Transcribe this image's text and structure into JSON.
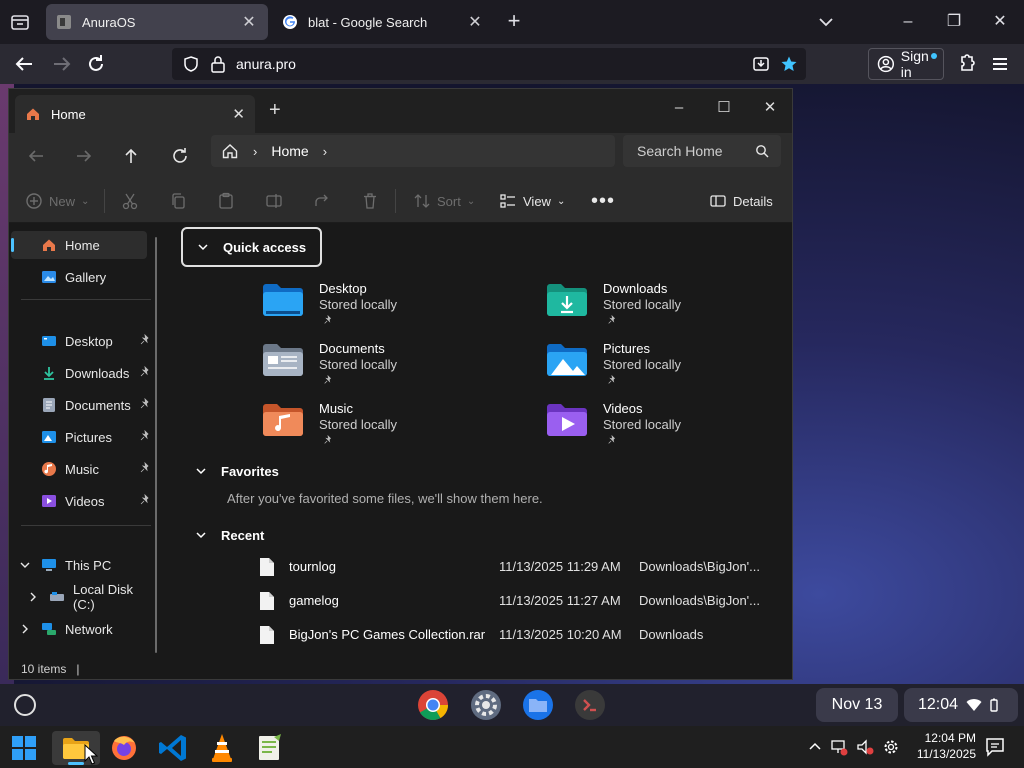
{
  "browser": {
    "tabs": [
      {
        "title": "AnuraOS",
        "active": true
      },
      {
        "title": "blat - Google Search",
        "active": false
      }
    ],
    "url": "anura.pro",
    "sign_in": "Sign in"
  },
  "explorer": {
    "tab_title": "Home",
    "breadcrumb": [
      "Home"
    ],
    "search_placeholder": "Search Home",
    "toolbar": {
      "new": "New",
      "sort": "Sort",
      "view": "View",
      "details": "Details"
    },
    "sidebar": {
      "home": "Home",
      "gallery": "Gallery",
      "quick": [
        {
          "label": "Desktop"
        },
        {
          "label": "Downloads"
        },
        {
          "label": "Documents"
        },
        {
          "label": "Pictures"
        },
        {
          "label": "Music"
        },
        {
          "label": "Videos"
        }
      ],
      "this_pc": "This PC",
      "local_disk": "Local Disk (C:)",
      "network": "Network"
    },
    "quick_access": {
      "header": "Quick access",
      "items": [
        {
          "name": "Desktop",
          "sub": "Stored locally"
        },
        {
          "name": "Downloads",
          "sub": "Stored locally"
        },
        {
          "name": "Documents",
          "sub": "Stored locally"
        },
        {
          "name": "Pictures",
          "sub": "Stored locally"
        },
        {
          "name": "Music",
          "sub": "Stored locally"
        },
        {
          "name": "Videos",
          "sub": "Stored locally"
        }
      ]
    },
    "favorites": {
      "header": "Favorites",
      "empty_text": "After you've favorited some files, we'll show them here."
    },
    "recent": {
      "header": "Recent",
      "rows": [
        {
          "name": "tournlog",
          "date": "11/13/2025 11:29 AM",
          "location": "Downloads\\BigJon'..."
        },
        {
          "name": "gamelog",
          "date": "11/13/2025 11:27 AM",
          "location": "Downloads\\BigJon'..."
        },
        {
          "name": "BigJon's PC Games Collection.rar",
          "date": "11/13/2025 10:20 AM",
          "location": "Downloads"
        }
      ]
    },
    "status": "10 items"
  },
  "shelf": {
    "date": "Nov 13",
    "time": "12:04"
  },
  "taskbar": {
    "time": "12:04 PM",
    "date": "11/13/2025"
  },
  "colors": {
    "accent": "#4cc2ff",
    "folder_blue": "#1e90e8",
    "folder_teal": "#1fb8a0",
    "folder_purple": "#8a4fe0",
    "folder_orange": "#e8784a"
  }
}
